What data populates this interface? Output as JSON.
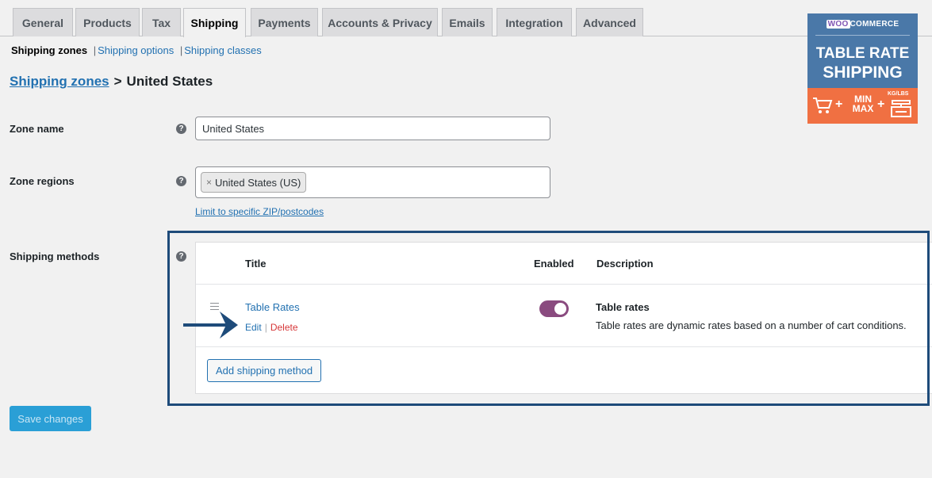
{
  "tabs": [
    {
      "label": "General"
    },
    {
      "label": "Products"
    },
    {
      "label": "Tax"
    },
    {
      "label": "Shipping",
      "active": true
    },
    {
      "label": "Payments"
    },
    {
      "label": "Accounts & Privacy"
    },
    {
      "label": "Emails"
    },
    {
      "label": "Integration"
    },
    {
      "label": "Advanced"
    }
  ],
  "subnav": {
    "current": "Shipping zones",
    "options": "Shipping options",
    "classes": "Shipping classes",
    "separator": "|"
  },
  "breadcrumb": {
    "link": "Shipping zones",
    "separator": ">",
    "current": "United States"
  },
  "zone_name": {
    "label": "Zone name",
    "value": "United States"
  },
  "zone_regions": {
    "label": "Zone regions",
    "chip": "United States (US)",
    "chip_remove": "×",
    "limit_link": "Limit to specific ZIP/postcodes"
  },
  "help_glyph": "?",
  "shipping_methods": {
    "label": "Shipping methods",
    "columns": {
      "title": "Title",
      "enabled": "Enabled",
      "description": "Description"
    },
    "rows": [
      {
        "title": "Table Rates",
        "edit": "Edit",
        "delete": "Delete",
        "enabled": true,
        "desc_title": "Table rates",
        "desc_text": "Table rates are dynamic rates based on a number of cart conditions."
      }
    ],
    "add_button": "Add shipping method"
  },
  "save_button": "Save changes",
  "promo": {
    "woo": "WOO",
    "commerce": "COMMERCE",
    "line1": "TABLE RATE",
    "line2": "SHIPPING",
    "minmax_1": "MIN",
    "minmax_2": "MAX",
    "plus": "+",
    "unit": "KG/LBS"
  },
  "colors": {
    "link": "#2271b1",
    "toggle_on": "#8a4b7f",
    "delete": "#d63638",
    "highlight_border": "#1e4b7a",
    "save_bg": "#2a9fd6",
    "promo_blue": "#4a78a8",
    "promo_orange": "#f07042"
  }
}
